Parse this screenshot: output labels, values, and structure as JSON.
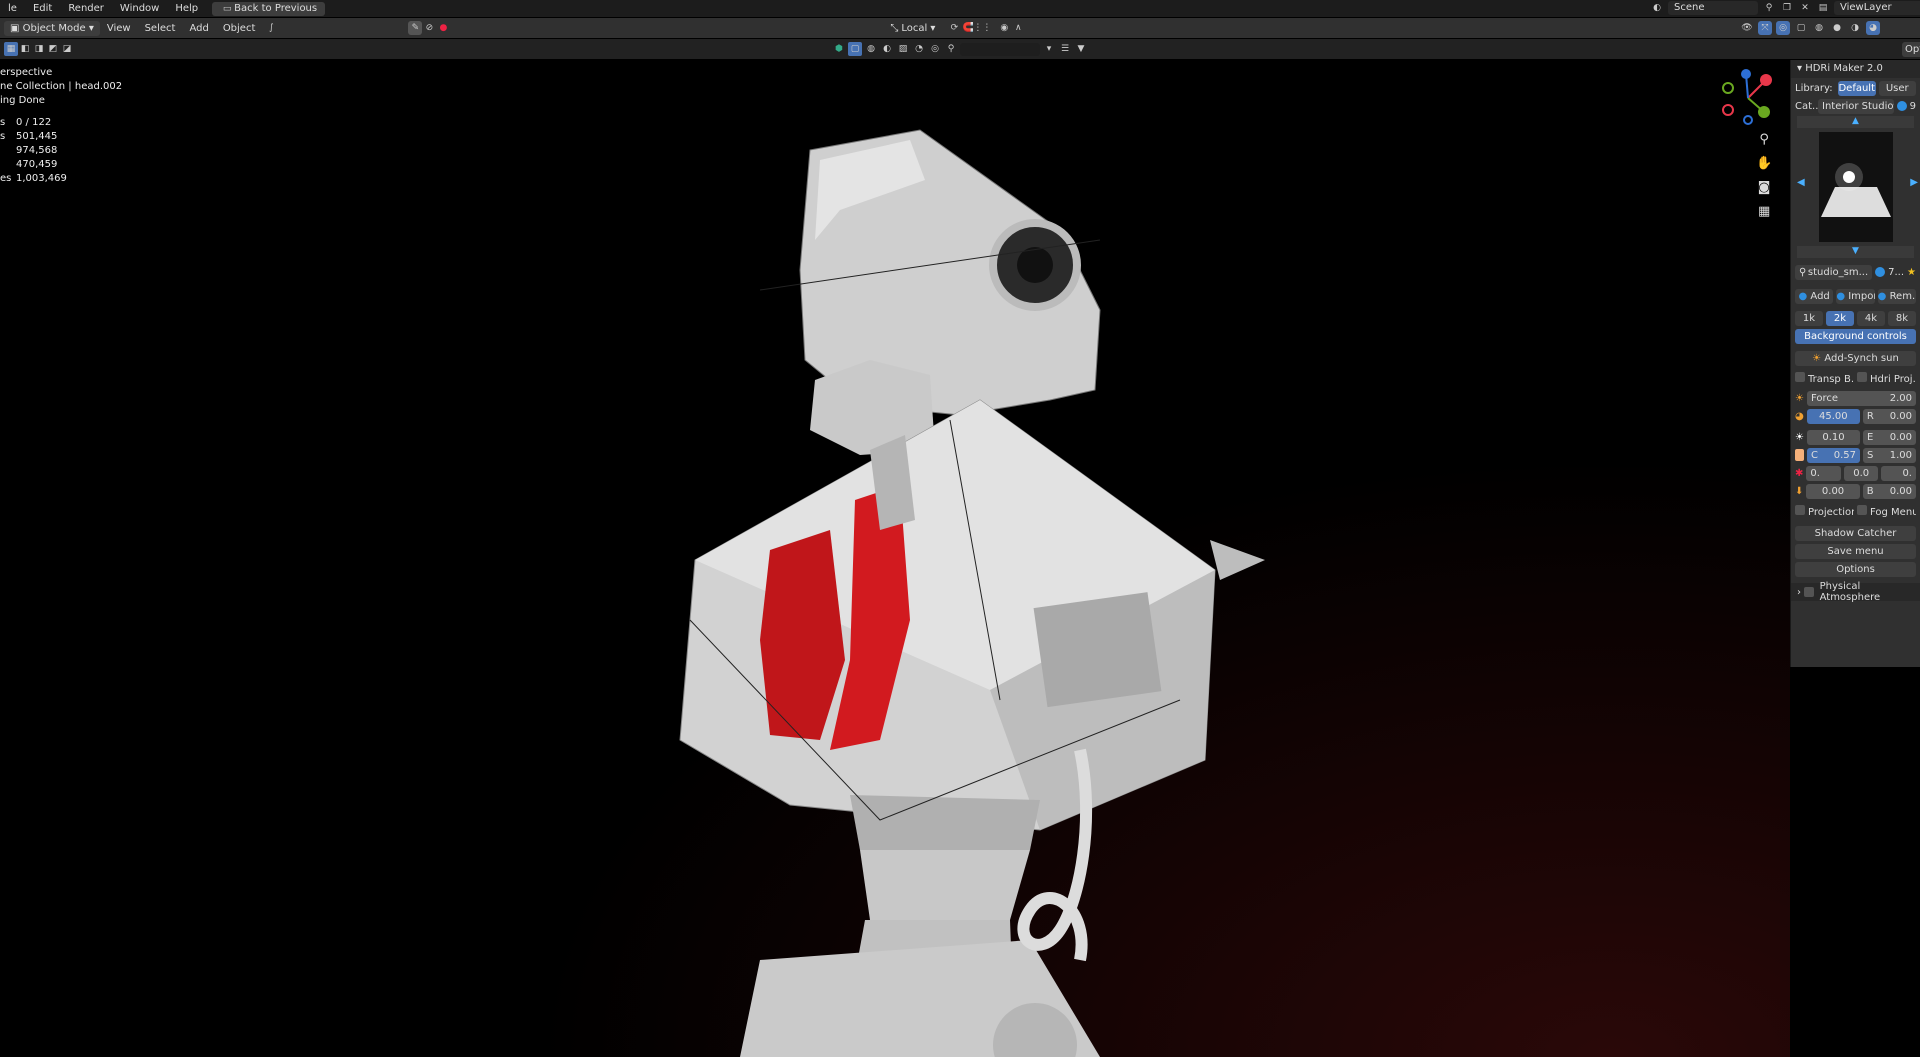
{
  "topbar": {
    "menus": [
      "le",
      "Edit",
      "Render",
      "Window",
      "Help"
    ],
    "back_button": "Back to Previous",
    "scene_name": "Scene",
    "view_layer": "ViewLayer"
  },
  "header": {
    "mode": "Object Mode",
    "menus": [
      "View",
      "Select",
      "Add",
      "Object"
    ],
    "transform_orientation": "Local"
  },
  "viewport": {
    "overlay_lines": [
      "erspective",
      "ne Collection | head.002",
      "ing Done"
    ],
    "stats": [
      {
        "key": "s",
        "value": "0 / 122"
      },
      {
        "key": "s",
        "value": "501,445"
      },
      {
        "key": "",
        "value": "974,568"
      },
      {
        "key": "",
        "value": "470,459"
      },
      {
        "key": "es",
        "value": "1,003,469"
      }
    ]
  },
  "hdri_panel": {
    "title": "HDRi Maker 2.0",
    "library_label": "Library:",
    "library_default": "Default",
    "library_user": "User",
    "category_label": "Cat..",
    "category_value": "Interior Studio",
    "category_extra": "9",
    "hdri_name": "studio_sm...",
    "hdri_count": "7...",
    "add_label": "Add",
    "import_label": "Import",
    "remove_label": "Rem...",
    "resolutions": [
      "1k",
      "2k",
      "4k",
      "8k"
    ],
    "active_resolution": "2k",
    "background_controls": "Background controls",
    "add_synch_sun": "Add-Synch sun",
    "transp_b": "Transp B...",
    "hdri_proj": "Hdri Proj...",
    "force_label": "Force",
    "force_value": "2.00",
    "rot_value": "45.00",
    "r_label": "R",
    "r_value": "0.00",
    "row_a_value": "0.10",
    "e_label": "E",
    "e_value": "0.00",
    "c_label": "C",
    "c_value": "0.57",
    "s_label": "S",
    "s_value": "1.00",
    "row_c_a": "0.",
    "row_c_b": "0.0",
    "row_c_c": "0.",
    "row_d_value": "0.00",
    "b_label": "B",
    "b_value": "0.00",
    "projection": "Projection...",
    "fog_menu": "Fog Menu",
    "shadow_catcher": "Shadow Catcher",
    "save_menu": "Save menu",
    "options": "Options",
    "physical_atmosphere": "Physical Atmosphere",
    "opt_tab": "Opt"
  },
  "colors": {
    "accent": "#4772b3",
    "red_part": "#c0161a",
    "robot": "#d9d9d9"
  }
}
